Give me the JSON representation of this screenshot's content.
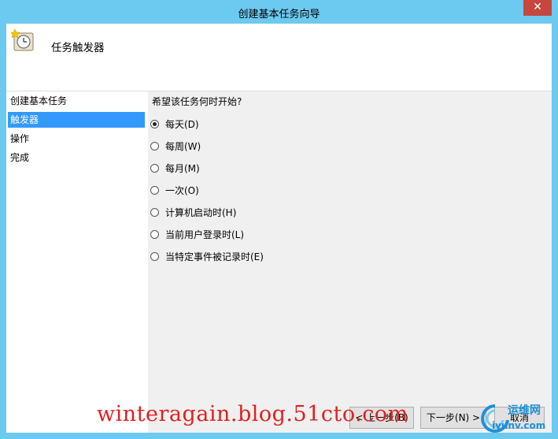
{
  "window": {
    "title": "创建基本任务向导",
    "close_label": "✕"
  },
  "header": {
    "icon": "clock-icon",
    "title": "任务触发器"
  },
  "steps": [
    {
      "label": "创建基本任务",
      "active": false
    },
    {
      "label": "触发器",
      "active": true
    },
    {
      "label": "操作",
      "active": false
    },
    {
      "label": "完成",
      "active": false
    }
  ],
  "content": {
    "question": "希望该任务何时开始?",
    "options": [
      {
        "label": "每天(D)",
        "checked": true
      },
      {
        "label": "每周(W)",
        "checked": false
      },
      {
        "label": "每月(M)",
        "checked": false
      },
      {
        "label": "一次(O)",
        "checked": false
      },
      {
        "label": "计算机启动时(H)",
        "checked": false
      },
      {
        "label": "当前用户登录时(L)",
        "checked": false
      },
      {
        "label": "当特定事件被记录时(E)",
        "checked": false
      }
    ]
  },
  "buttons": {
    "back": "< 上一步(B)",
    "next": "下一步(N) >",
    "cancel": "取消"
  },
  "watermark": {
    "text": "winteragain.blog.51cto.com"
  },
  "logo": {
    "name": "运维网",
    "domain": "iyunv.com"
  },
  "colors": {
    "titlebar": "#6cc9ef",
    "close": "#c7463e",
    "selection": "#3399ff",
    "watermark": "#e02020"
  }
}
